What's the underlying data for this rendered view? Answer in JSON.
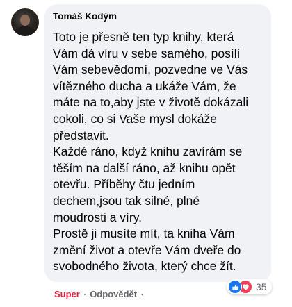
{
  "comment": {
    "author": "Tomáš Kodým",
    "lines": [
      "Toto je přesně ten typ knihy, která",
      "Vám dá víru v sebe samého, posílí",
      "Vám sebevědomí, pozvedne ve Vás",
      "vítězného ducha a ukáže Vám, že",
      "máte na to,aby jste v životě dokázali",
      "cokoli, co si Vaše mysl dokáže",
      "představit.",
      "Každé ráno, když knihu zavírám se",
      "těším na další ráno, až knihu opět",
      "otevřu. Příběhy čtu jedním",
      "dechem,jsou tak silné, plné",
      "moudrosti a víry.",
      "Prostě ji musíte mít, ta kniha Vám",
      "změní život a otevře Vám dveře do",
      "svobodného života, který chce žít."
    ]
  },
  "reactions": {
    "icons": [
      "like-icon",
      "love-icon"
    ],
    "count": "35"
  },
  "actions": {
    "reaction_label": "Super",
    "separator": "·",
    "reply_label": "Odpovědět"
  },
  "colors": {
    "bubble": "#f0f2f5",
    "like": "#1877f2",
    "love": "#f33e58",
    "super": "#e41e3f",
    "meta": "#65676b"
  }
}
